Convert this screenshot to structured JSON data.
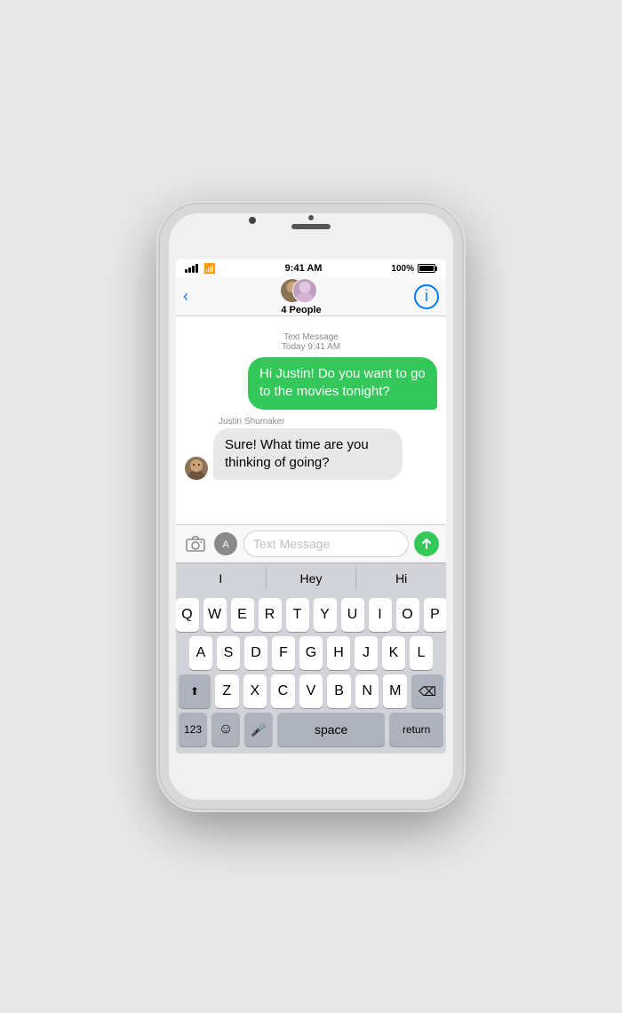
{
  "phone": {
    "status_bar": {
      "time": "9:41 AM",
      "battery": "100%",
      "signal_bars": 4,
      "wifi": true
    },
    "nav": {
      "back_label": "‹",
      "group_name": "4 People",
      "info_label": "i"
    },
    "messages": {
      "timestamp_type": "Text Message",
      "timestamp_time": "Today 9:41 AM",
      "outgoing": {
        "text": "Hi Justin! Do you want to go to the movies tonight?"
      },
      "incoming_sender": "Justin Shumaker",
      "incoming": {
        "text": "Sure! What time are you thinking of going?"
      }
    },
    "input": {
      "placeholder": "Text Message",
      "camera_icon": "📷",
      "apps_icon": "⊞"
    },
    "autocomplete": {
      "items": [
        "I",
        "Hey",
        "Hi"
      ]
    },
    "keyboard": {
      "rows": [
        [
          "Q",
          "W",
          "E",
          "R",
          "T",
          "Y",
          "U",
          "I",
          "O",
          "P"
        ],
        [
          "A",
          "S",
          "D",
          "F",
          "G",
          "H",
          "J",
          "K",
          "L"
        ],
        [
          "Z",
          "X",
          "C",
          "V",
          "B",
          "N",
          "M"
        ]
      ],
      "bottom": {
        "numbers": "123",
        "emoji": "☺",
        "mic": "mic",
        "space": "space",
        "return": "return",
        "delete": "⌫",
        "shift": "⬆"
      }
    }
  }
}
